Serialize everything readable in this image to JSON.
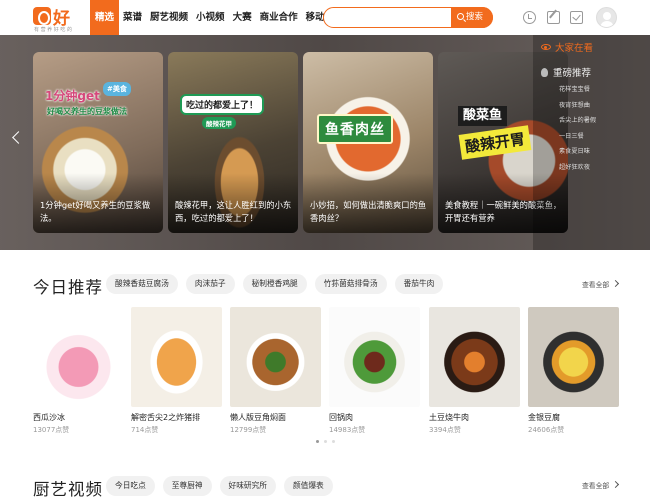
{
  "logo": {
    "text": "好豆",
    "subtitle": "有 营 养 好 吃 的"
  },
  "nav": [
    "精选",
    "菜谱",
    "厨艺视频",
    "小视频",
    "大赛",
    "商业合作",
    "移动端"
  ],
  "search": {
    "placeholder": "",
    "button": "搜索"
  },
  "header_icons": [
    "clock-icon",
    "edit-icon",
    "checklist-icon",
    "avatar"
  ],
  "banner": {
    "cards": [
      {
        "caption": "1分钟get好喝又养生的豆浆做法。",
        "badges": [
          "1分钟get",
          "#美食",
          "好喝又养生的豆浆做法"
        ]
      },
      {
        "caption": "酸辣花甲，这让人胜红到的小东西，吃过的都爱上了！",
        "badges": [
          "吃过的都爱上了！",
          "酸辣花甲"
        ]
      },
      {
        "caption": "小妙招，如何做出清脆爽口的鱼香肉丝？",
        "badges": [
          "鱼香肉丝"
        ]
      },
      {
        "caption": "美食教程｜一碗鲜美的酸菜鱼，开胃还有营养",
        "badges": [
          "酸菜鱼",
          "酸辣开胃"
        ]
      }
    ],
    "side": {
      "live_label": "大家在看",
      "hot_label": "重磅推荐",
      "items": [
        "花样宝宝餐",
        "夜宵狂想曲",
        "舌尖上的暑假",
        "一日三餐",
        "素食夏日味",
        "超好狂欢夜"
      ]
    }
  },
  "today": {
    "title": "今日推荐",
    "see_all": "查看全部",
    "tags": [
      "酸辣香菇豆腐汤",
      "肉沫茄子",
      "秘制橙香鸡腿",
      "竹荪菌菇排骨汤",
      "番茄牛肉"
    ],
    "dishes": [
      {
        "name": "西瓜沙冰",
        "likes": "13077点赞"
      },
      {
        "name": "解密舌尖2之炸猪排",
        "likes": "714点赞"
      },
      {
        "name": "懒人版豆角焖面",
        "likes": "12799点赞"
      },
      {
        "name": "回锅肉",
        "likes": "14983点赞"
      },
      {
        "name": "土豆烧牛肉",
        "likes": "3394点赞"
      },
      {
        "name": "金银豆腐",
        "likes": "24606点赞"
      }
    ]
  },
  "video": {
    "title": "厨艺视频",
    "see_all": "查看全部",
    "tags": [
      "今日吃点",
      "至尊厨神",
      "好味研究所",
      "颜值爆表"
    ]
  }
}
